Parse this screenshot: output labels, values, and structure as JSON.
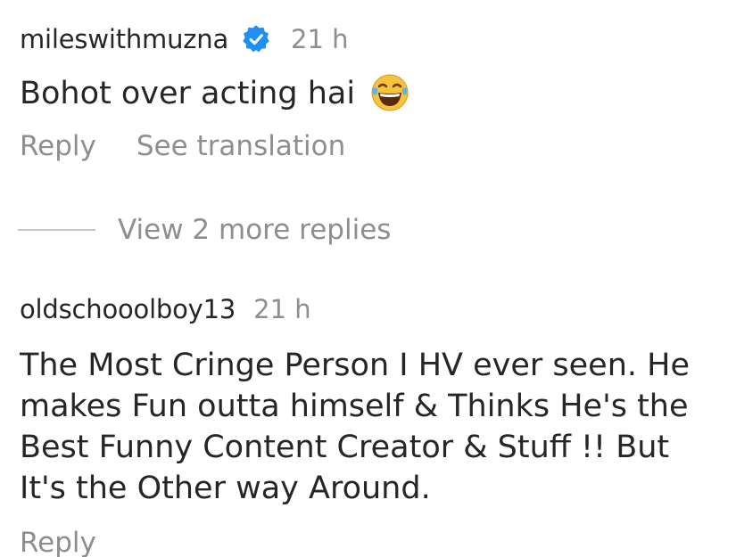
{
  "comments": [
    {
      "username": "mileswithmuzna",
      "verified": true,
      "time": "21 h",
      "text": "Bohot over acting hai",
      "emoji": "face-with-tears-of-joy",
      "actions": {
        "reply": "Reply",
        "translate": "See translation"
      }
    },
    {
      "username": "oldschooolboy13",
      "verified": false,
      "time": "21 h",
      "text": "The Most Cringe Person I HV ever seen. He makes Fun outta himself & Thinks He's the Best Funny Content Creator & Stuff !! But It's the Other way Around.",
      "actions": {
        "reply": "Reply"
      }
    }
  ],
  "view_more": "View 2 more replies",
  "colors": {
    "text": "#262626",
    "muted": "#8e8e8e",
    "verified": "#1f8ff5"
  }
}
